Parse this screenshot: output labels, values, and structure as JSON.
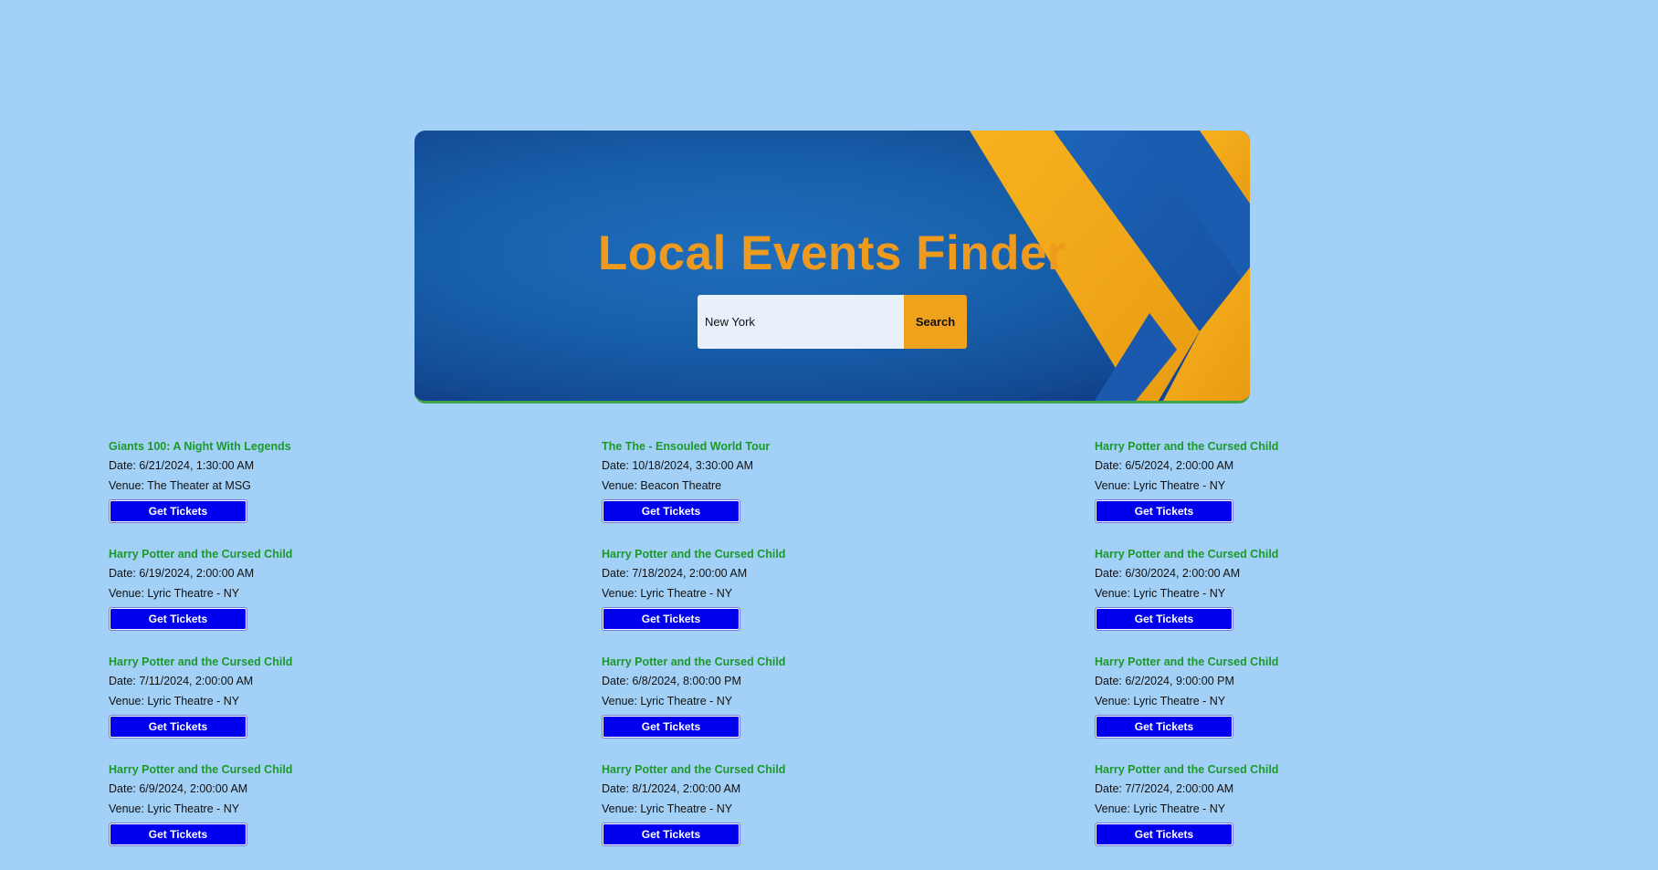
{
  "app": {
    "title": "Local Events Finder"
  },
  "search": {
    "value": "New York",
    "button_label": "Search"
  },
  "colors": {
    "page_background": "#a2d0f7",
    "title": "#ee9a1f",
    "event_name": "#1b9a2a",
    "ticket_button": "#0000ee",
    "search_button": "#f0a21c"
  },
  "events": [
    {
      "name": "Giants 100: A Night With Legends",
      "date": "Date: 6/21/2024, 1:30:00 AM",
      "venue": "Venue: The Theater at MSG",
      "button_label": "Get Tickets"
    },
    {
      "name": "The The - Ensouled World Tour",
      "date": "Date: 10/18/2024, 3:30:00 AM",
      "venue": "Venue: Beacon Theatre",
      "button_label": "Get Tickets"
    },
    {
      "name": "Harry Potter and the Cursed Child",
      "date": "Date: 6/5/2024, 2:00:00 AM",
      "venue": "Venue: Lyric Theatre - NY",
      "button_label": "Get Tickets"
    },
    {
      "name": "Harry Potter and the Cursed Child",
      "date": "Date: 6/19/2024, 2:00:00 AM",
      "venue": "Venue: Lyric Theatre - NY",
      "button_label": "Get Tickets"
    },
    {
      "name": "Harry Potter and the Cursed Child",
      "date": "Date: 7/18/2024, 2:00:00 AM",
      "venue": "Venue: Lyric Theatre - NY",
      "button_label": "Get Tickets"
    },
    {
      "name": "Harry Potter and the Cursed Child",
      "date": "Date: 6/30/2024, 2:00:00 AM",
      "venue": "Venue: Lyric Theatre - NY",
      "button_label": "Get Tickets"
    },
    {
      "name": "Harry Potter and the Cursed Child",
      "date": "Date: 7/11/2024, 2:00:00 AM",
      "venue": "Venue: Lyric Theatre - NY",
      "button_label": "Get Tickets"
    },
    {
      "name": "Harry Potter and the Cursed Child",
      "date": "Date: 6/8/2024, 8:00:00 PM",
      "venue": "Venue: Lyric Theatre - NY",
      "button_label": "Get Tickets"
    },
    {
      "name": "Harry Potter and the Cursed Child",
      "date": "Date: 6/2/2024, 9:00:00 PM",
      "venue": "Venue: Lyric Theatre - NY",
      "button_label": "Get Tickets"
    },
    {
      "name": "Harry Potter and the Cursed Child",
      "date": "Date: 6/9/2024, 2:00:00 AM",
      "venue": "Venue: Lyric Theatre - NY",
      "button_label": "Get Tickets"
    },
    {
      "name": "Harry Potter and the Cursed Child",
      "date": "Date: 8/1/2024, 2:00:00 AM",
      "venue": "Venue: Lyric Theatre - NY",
      "button_label": "Get Tickets"
    },
    {
      "name": "Harry Potter and the Cursed Child",
      "date": "Date: 7/7/2024, 2:00:00 AM",
      "venue": "Venue: Lyric Theatre - NY",
      "button_label": "Get Tickets"
    }
  ]
}
